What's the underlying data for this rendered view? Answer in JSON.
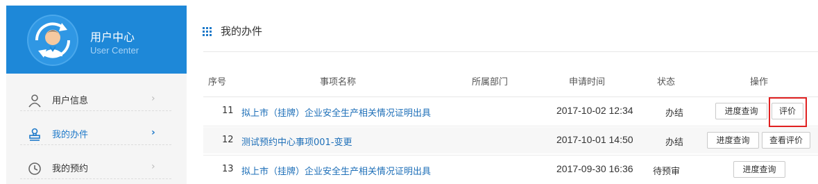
{
  "sidebar": {
    "title": "用户中心",
    "subtitle": "User Center",
    "items": [
      {
        "label": "用户信息",
        "icon": "user-icon",
        "active": false
      },
      {
        "label": "我的办件",
        "icon": "stamp-icon",
        "active": true
      },
      {
        "label": "我的预约",
        "icon": "clock-icon",
        "active": false
      }
    ],
    "accent_color": "#1e88d8"
  },
  "main": {
    "title": "我的办件",
    "columns": [
      "序号",
      "事项名称",
      "所属部门",
      "申请时间",
      "状态",
      "操作"
    ],
    "rows": [
      {
        "index": "11",
        "name": "拟上市（挂牌）企业安全生产相关情况证明出具",
        "department": "",
        "time": "2017-10-02 12:34",
        "status": "办结",
        "actions": [
          "进度查询",
          "评价"
        ]
      },
      {
        "index": "12",
        "name": "测试预约中心事项001-变更",
        "department": "",
        "time": "2017-10-01 14:50",
        "status": "办结",
        "actions": [
          "进度查询",
          "查看评价"
        ]
      },
      {
        "index": "13",
        "name": "拟上市（挂牌）企业安全生产相关情况证明出具",
        "department": "",
        "time": "2017-09-30 16:36",
        "status": "待预审",
        "actions": [
          "进度查询"
        ]
      }
    ]
  }
}
